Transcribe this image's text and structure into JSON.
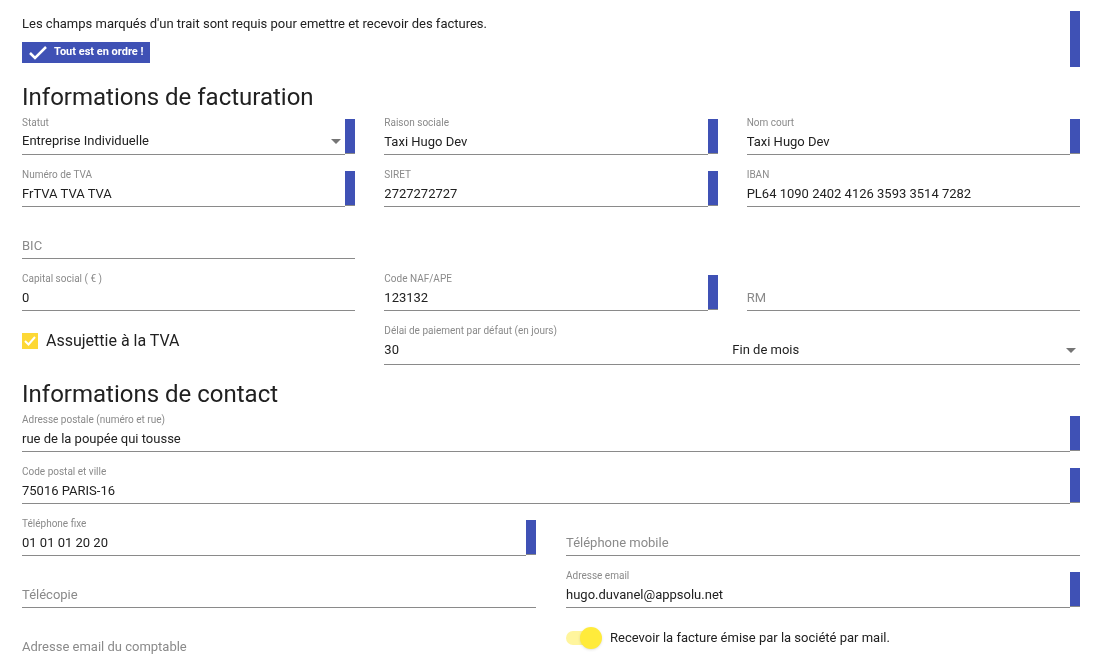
{
  "notice": "Les champs marqués d'un trait sont requis pour emettre et recevoir des factures.",
  "status_badge": {
    "label": "Tout est en ordre !",
    "ok": true
  },
  "sections": [
    {
      "title": "Informations de facturation",
      "rows": [
        [
          {
            "kind": "select",
            "label": "Statut",
            "value": "Entreprise Individuelle",
            "required": true
          },
          {
            "kind": "text",
            "label": "Raison sociale",
            "value": "Taxi Hugo Dev",
            "required": true
          },
          {
            "kind": "text",
            "label": "Nom court",
            "value": "Taxi Hugo Dev",
            "required": true
          }
        ],
        [
          {
            "kind": "text",
            "label": "Numéro de TVA",
            "value": "FrTVA TVA TVA",
            "required": true
          },
          {
            "kind": "text",
            "label": "SIRET",
            "value": "2727272727",
            "required": true
          },
          {
            "kind": "text",
            "label": "IBAN",
            "value": "PL64 1090 2402 4126 3593 3514 7282",
            "required": false
          }
        ],
        [
          {
            "kind": "text",
            "placeholder": "BIC",
            "required": false
          }
        ],
        [
          {
            "kind": "text",
            "label": "Capital social ( € )",
            "value": "0",
            "required": false
          },
          {
            "kind": "text",
            "label": "Code NAF/APE",
            "value": "123132",
            "required": true
          },
          {
            "kind": "text",
            "placeholder": "RM",
            "required": false
          }
        ],
        [
          {
            "kind": "checkbox",
            "label": "Assujettie à la TVA",
            "checked": true
          },
          {
            "kind": "delay",
            "label": "Délai de paiement par défaut (en jours)",
            "value": "30",
            "option": "Fin de mois"
          }
        ]
      ]
    },
    {
      "title": "Informations de contact",
      "rows": [
        [
          {
            "kind": "text",
            "label": "Adresse postale (numéro et rue)",
            "value": "rue de la poupée qui tousse",
            "required": true,
            "wide": true
          }
        ],
        [
          {
            "kind": "text",
            "label": "Code postal et ville",
            "value": "75016 PARIS-16",
            "required": true,
            "wide": true
          }
        ],
        [
          {
            "kind": "text",
            "label": "Téléphone fixe",
            "value": "01 01 01 20 20",
            "required": true
          },
          {
            "kind": "text",
            "placeholder": "Téléphone mobile",
            "required": false
          }
        ],
        [
          {
            "kind": "text",
            "placeholder": "Télécopie",
            "required": false
          },
          {
            "kind": "text",
            "label": "Adresse email",
            "value": "hugo.duvanel@appsolu.net",
            "required": true
          }
        ],
        [
          {
            "kind": "text",
            "placeholder": "Adresse email du comptable",
            "required": false
          },
          {
            "kind": "toggle",
            "label": "Recevoir la facture émise par la société par mail.",
            "on": true
          }
        ]
      ]
    }
  ]
}
